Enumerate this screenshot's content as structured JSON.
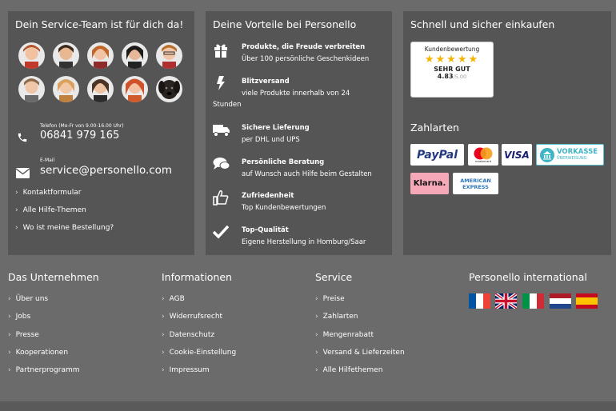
{
  "service": {
    "title": "Dein Service-Team ist für dich da!",
    "phone_label": "Telefon (Mo-Fr von 9.00-16.00 Uhr)",
    "phone_number": "06841 979 165",
    "email_label": "E-Mail",
    "email": "service@personello.com",
    "links": [
      "Kontaktformular",
      "Alle Hilfe-Themen",
      "Wo ist meine Bestellung?"
    ]
  },
  "advantages": {
    "title": "Deine Vorteile bei Personello",
    "items": [
      {
        "icon": "gift-icon",
        "title": "Produkte, die Freude verbreiten",
        "sub": "Über 100 persönliche Geschenkideen"
      },
      {
        "icon": "lightning-icon",
        "title": "Blitzversand",
        "sub": "viele Produkte innerhalb von 24",
        "sub2": "Stunden"
      },
      {
        "icon": "truck-icon",
        "title": "Sichere Lieferung",
        "sub": "per DHL und UPS"
      },
      {
        "icon": "chat-icon",
        "title": "Persönliche Beratung",
        "sub": "auf Wunsch auch Hilfe beim Gestalten"
      },
      {
        "icon": "thumbs-up-icon",
        "title": "Zufriedenheit",
        "sub": "Top Kundenbewertungen"
      },
      {
        "icon": "checkmark-icon",
        "title": "Top-Qualität",
        "sub": "Eigene Herstellung in Homburg/Saar"
      }
    ]
  },
  "shop": {
    "title": "Schnell und sicher einkaufen",
    "rating_header": "Kundenbewertung",
    "stars": "★★★★★",
    "rating_verdict": "SEHR GUT",
    "rating_score": "4.83",
    "rating_max": "/5.00",
    "payments_title": "Zahlarten",
    "payments": {
      "paypal": "PayPal",
      "mastercard": "mastercard",
      "visa": "VISA",
      "vorkasse": "VORKASSE",
      "vorkasse_sub": "ÜBERWEISUNG",
      "klarna": "Klarna.",
      "amex1": "AMERICAN",
      "amex2": "EXPRESS"
    }
  },
  "footer": {
    "columns": [
      {
        "title": "Das Unternehmen",
        "links": [
          "Über uns",
          "Jobs",
          "Presse",
          "Kooperationen",
          "Partnerprogramm"
        ]
      },
      {
        "title": "Informationen",
        "links": [
          "AGB",
          "Widerrufsrecht",
          "Datenschutz",
          "Cookie-Einstellung",
          "Impressum"
        ]
      },
      {
        "title": "Service",
        "links": [
          "Preise",
          "Zahlarten",
          "Mengenrabatt",
          "Versand & Lieferzeiten",
          "Alle Hilfethemen"
        ]
      }
    ],
    "international_title": "Personello international",
    "flags": [
      "flag-france-icon",
      "flag-uk-icon",
      "flag-italy-icon",
      "flag-netherlands-icon",
      "flag-spain-icon"
    ]
  },
  "colors": {
    "background": "#6b6b6b",
    "panel": "#555555",
    "star": "#f5b400"
  }
}
